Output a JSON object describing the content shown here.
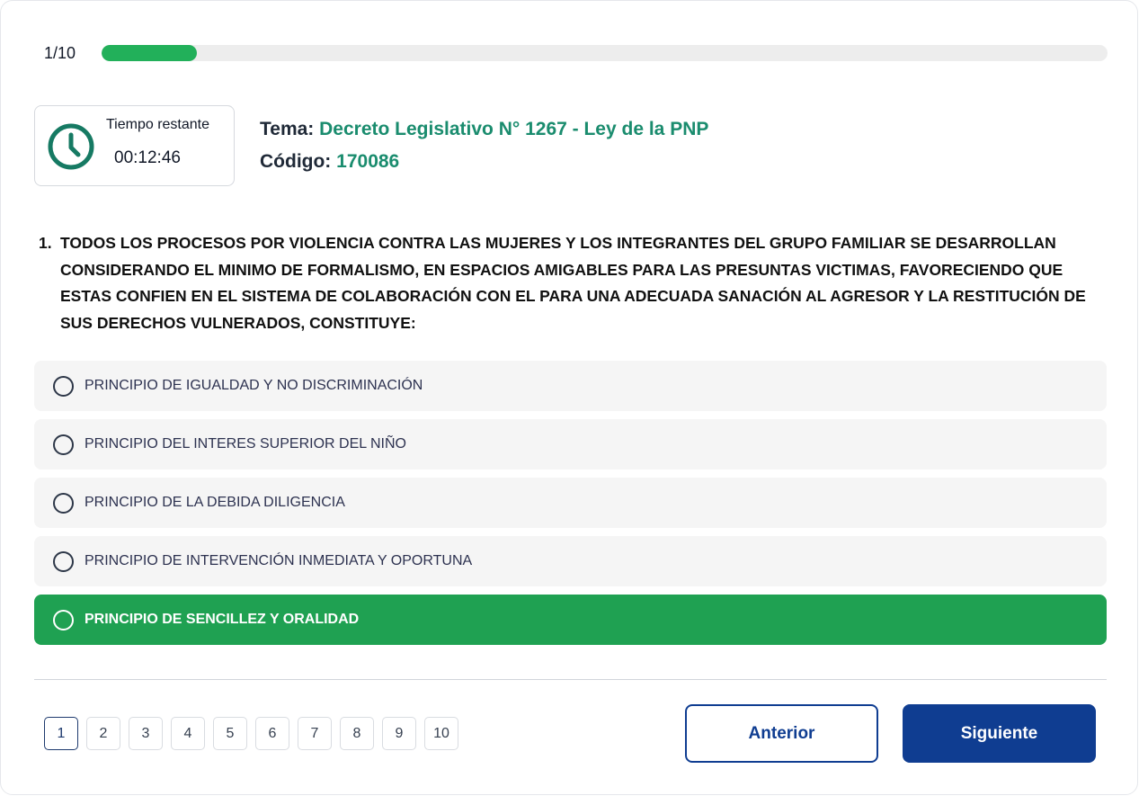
{
  "progress": {
    "label": "1/10",
    "fraction": 0.095,
    "color": "#22b05a"
  },
  "timer": {
    "icon": "clock-icon",
    "label": "Tiempo restante",
    "value": "00:12:46"
  },
  "topic": {
    "tema_key": "Tema:",
    "tema_value": "Decreto Legislativo N° 1267 - Ley de la PNP",
    "codigo_key": "Código:",
    "codigo_value": "170086",
    "value_color": "#1a8c6e"
  },
  "question": {
    "number": "1.",
    "text": "TODOS LOS PROCESOS POR VIOLENCIA CONTRA LAS MUJERES Y LOS INTEGRANTES DEL GRUPO FAMILIAR SE DESARROLLAN CONSIDERANDO EL MINIMO DE FORMALISMO, EN ESPACIOS AMIGABLES PARA LAS PRESUNTAS VICTIMAS, FAVORECIENDO QUE ESTAS CONFIEN EN EL SISTEMA DE COLABORACIÓN CON EL PARA UNA ADECUADA SANACIÓN AL AGRESOR Y LA RESTITUCIÓN DE SUS DERECHOS VULNERADOS, CONSTITUYE:"
  },
  "options": [
    {
      "label": "PRINCIPIO DE IGUALDAD Y NO DISCRIMINACIÓN",
      "selected": false
    },
    {
      "label": "PRINCIPIO DEL INTERES SUPERIOR DEL NIÑO",
      "selected": false
    },
    {
      "label": "PRINCIPIO DE LA DEBIDA DILIGENCIA",
      "selected": false
    },
    {
      "label": "PRINCIPIO DE INTERVENCIÓN INMEDIATA Y OPORTUNA",
      "selected": false
    },
    {
      "label": "PRINCIPIO DE SENCILLEZ Y ORALIDAD",
      "selected": true
    }
  ],
  "pagination": {
    "pages": [
      "1",
      "2",
      "3",
      "4",
      "5",
      "6",
      "7",
      "8",
      "9",
      "10"
    ],
    "current": "1"
  },
  "nav": {
    "prev_label": "Anterior",
    "next_label": "Siguiente",
    "primary_color": "#0f3d91"
  },
  "colors": {
    "selected_option": "#1fa152",
    "option_bg": "#f5f5f5"
  }
}
